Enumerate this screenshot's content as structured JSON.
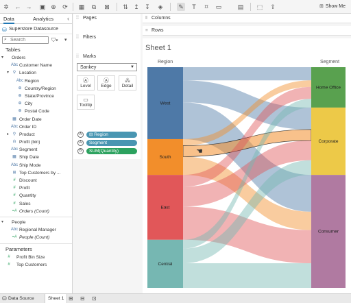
{
  "toolbar": {
    "show_me_label": "Show Me"
  },
  "left_pane": {
    "tab_data": "Data",
    "tab_analytics": "Analytics",
    "datasource": "Superstore Datasource",
    "search_placeholder": "Search",
    "tables_heading": "Tables",
    "parameters_heading": "Parameters",
    "fields": [
      {
        "label": "Orders",
        "type": "",
        "caret": "▾",
        "indent": 0
      },
      {
        "label": "Customer Name",
        "type": "Abc",
        "indent": 1
      },
      {
        "label": "Location",
        "type": "⚲",
        "caret": "▾",
        "indent": 1
      },
      {
        "label": "Region",
        "type": "Abc",
        "indent": 2
      },
      {
        "label": "Country/Region",
        "type": "⊕",
        "indent": 2
      },
      {
        "label": "State/Province",
        "type": "⊕",
        "indent": 2
      },
      {
        "label": "City",
        "type": "⊕",
        "indent": 2
      },
      {
        "label": "Postal Code",
        "type": "⊕",
        "indent": 2
      },
      {
        "label": "Order Date",
        "type": "▦",
        "indent": 1
      },
      {
        "label": "Order ID",
        "type": "Abc",
        "indent": 1
      },
      {
        "label": "Product",
        "type": "⚲",
        "caret": "▸",
        "indent": 1
      },
      {
        "label": "Profit (bin)",
        "type": "ılı",
        "indent": 1
      },
      {
        "label": "Segment",
        "type": "Abc",
        "indent": 1
      },
      {
        "label": "Ship Date",
        "type": "▦",
        "indent": 1
      },
      {
        "label": "Ship Mode",
        "type": "Abc",
        "indent": 1
      },
      {
        "label": "Top Customers by ...",
        "type": "⊞",
        "indent": 1
      },
      {
        "label": "Discount",
        "type": "#",
        "indent": 1,
        "green": true
      },
      {
        "label": "Profit",
        "type": "#",
        "indent": 1,
        "green": true
      },
      {
        "label": "Quantity",
        "type": "#",
        "indent": 1,
        "green": true
      },
      {
        "label": "Sales",
        "type": "#",
        "indent": 1,
        "green": true
      },
      {
        "label": "Orders (Count)",
        "type": "=#",
        "indent": 1,
        "green": true,
        "italic": true
      }
    ],
    "people": [
      {
        "label": "People",
        "type": "",
        "caret": "▾",
        "indent": 0
      },
      {
        "label": "Regional Manager",
        "type": "Abc",
        "indent": 1
      },
      {
        "label": "People (Count)",
        "type": "=#",
        "indent": 1,
        "green": true,
        "italic": true
      }
    ],
    "parameters": [
      {
        "label": "Profit Bin Size",
        "type": "#"
      },
      {
        "label": "Top Customers",
        "type": "#"
      }
    ]
  },
  "cards": {
    "pages": "Pages",
    "filters": "Filters",
    "marks": "Marks",
    "mark_type": "Sankey",
    "buttons": {
      "level": "Level",
      "edge": "Edge",
      "detail": "Detail",
      "tooltip": "Tooltip"
    },
    "pills": [
      {
        "label": "⊟ Region",
        "icon": "A",
        "color": "#4996b2"
      },
      {
        "label": "Segment",
        "icon": "A",
        "color": "#4996b2"
      },
      {
        "label": "SUM(Quantity)",
        "icon": "B",
        "color": "#2ca25f"
      }
    ]
  },
  "shelves": {
    "columns": "Columns",
    "rows": "Rows"
  },
  "sheet": {
    "title": "Sheet 1",
    "left_header": "Region",
    "right_header": "Segment",
    "regions": [
      {
        "name": "West",
        "color": "#4e79a7",
        "value": 0.326
      },
      {
        "name": "South",
        "color": "#f28e2b",
        "value": 0.162
      },
      {
        "name": "East",
        "color": "#e15759",
        "value": 0.294
      },
      {
        "name": "Central",
        "color": "#76b7b2",
        "value": 0.218
      }
    ],
    "segments": [
      {
        "name": "Home Office",
        "color": "#59a14f",
        "value": 0.183
      },
      {
        "name": "Corporate",
        "color": "#edc948",
        "value": 0.305
      },
      {
        "name": "Consumer",
        "color": "#b07aa1",
        "value": 0.512
      }
    ]
  },
  "status": {
    "datasource_tab": "Data Source",
    "sheet_tab": "Sheet 1"
  }
}
